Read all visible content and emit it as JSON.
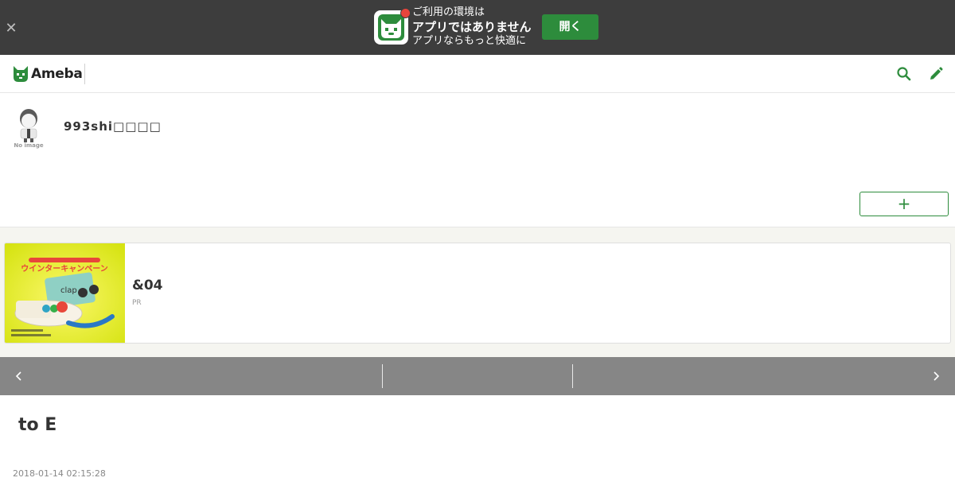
{
  "app_banner": {
    "close_icon": "close-icon",
    "line1": "ご利用の環境は",
    "line2": "アプリではありません",
    "line3": "アプリならもっと快適に",
    "open_button": "開く",
    "accent": "#2d8c3c"
  },
  "header": {
    "logo_text": "Ameba",
    "search_icon": "search-icon",
    "edit_icon": "pencil-icon"
  },
  "profile": {
    "avatar_caption": "No image",
    "blog_name": "993shi□□□□",
    "follow_button": "+"
  },
  "ad": {
    "image_headline": "ウインターキャンペーン",
    "image_brand": "clap",
    "title": "&04",
    "pr_label": "PR"
  },
  "pager": {
    "prev_icon": "chevron-left-icon",
    "next_icon": "chevron-right-icon"
  },
  "entry": {
    "title": "to E",
    "date": "2018-01-14 02:15:28"
  }
}
